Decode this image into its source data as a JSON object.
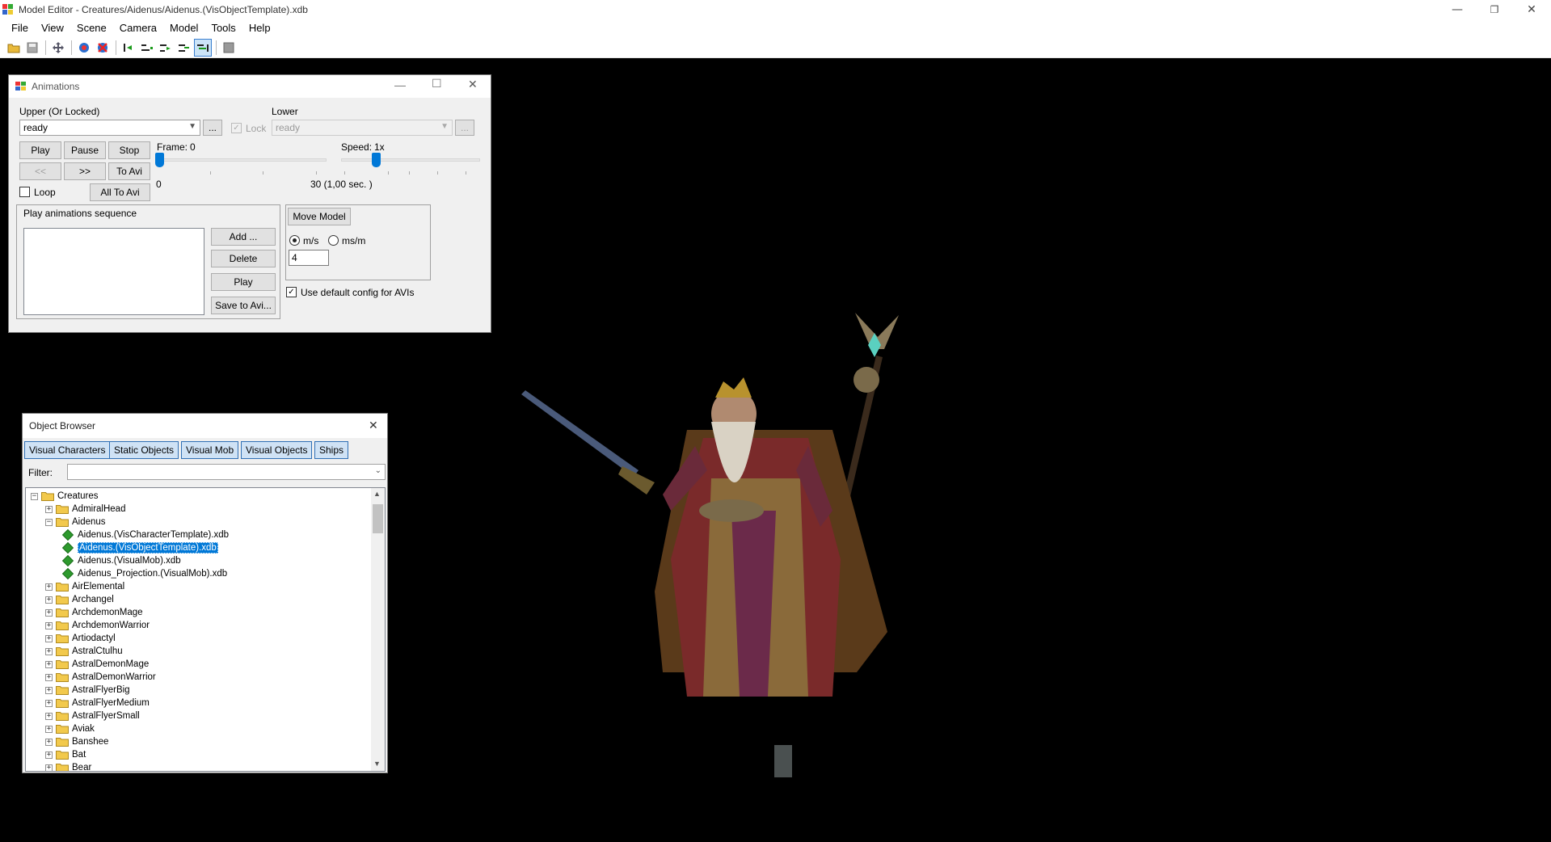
{
  "title": "Model Editor - Creatures/Aidenus/Aidenus.(VisObjectTemplate).xdb",
  "window_controls": {
    "minimize": "—",
    "restore": "❐",
    "close": "✕"
  },
  "menu": [
    "File",
    "View",
    "Scene",
    "Camera",
    "Model",
    "Tools",
    "Help"
  ],
  "toolbar_icons": [
    "open-icon",
    "save-icon",
    "move-icon",
    "reload-icon",
    "remove-icon",
    "anim-start-icon",
    "anim-prev-icon",
    "anim-next-icon",
    "anim-step-icon",
    "anim-end-icon",
    "grid-icon"
  ],
  "animations": {
    "title": "Animations",
    "upper_label": "Upper (Or Locked)",
    "upper_value": "ready",
    "upper_more": "...",
    "lock_label": "Lock",
    "lower_label": "Lower",
    "lower_value": "ready",
    "lower_more": "...",
    "play": "Play",
    "pause": "Pause",
    "stop": "Stop",
    "prev": "<<",
    "next": ">>",
    "to_avi": "To Avi",
    "loop": "Loop",
    "all_to_avi": "All To Avi",
    "frame_label": "Frame:",
    "frame_value": "0",
    "frame_min": "0",
    "frame_max": "30 (1,00 sec. )",
    "frame_position": 0,
    "speed_label": "Speed:",
    "speed_value": "1x",
    "speed_position": 0.25,
    "sequence_label": "Play animations sequence",
    "add": "Add ...",
    "delete": "Delete",
    "seq_play": "Play",
    "save_to_avi": "Save to Avi...",
    "move_model": "Move Model",
    "unit_ms": "m/s",
    "unit_msm": "ms/m",
    "move_value": "4",
    "use_default": "Use default config for AVIs"
  },
  "object_browser": {
    "title": "Object Browser",
    "tabs": [
      "Visual Characters",
      "Static Objects",
      "Visual Mob",
      "Visual Objects",
      "Ships"
    ],
    "filter_label": "Filter:",
    "filter_value": "",
    "tree": [
      {
        "label": "Creatures",
        "level": 0,
        "type": "folder",
        "expander": "−"
      },
      {
        "label": "AdmiralHead",
        "level": 1,
        "type": "folder",
        "expander": "+"
      },
      {
        "label": "Aidenus",
        "level": 1,
        "type": "folder",
        "expander": "−"
      },
      {
        "label": "Aidenus.(VisCharacterTemplate).xdb",
        "level": 2,
        "type": "file"
      },
      {
        "label": "Aidenus.(VisObjectTemplate).xdb",
        "level": 2,
        "type": "file",
        "selected": true
      },
      {
        "label": "Aidenus.(VisualMob).xdb",
        "level": 2,
        "type": "file"
      },
      {
        "label": "Aidenus_Projection.(VisualMob).xdb",
        "level": 2,
        "type": "file"
      },
      {
        "label": "AirElemental",
        "level": 1,
        "type": "folder",
        "expander": "+"
      },
      {
        "label": "Archangel",
        "level": 1,
        "type": "folder",
        "expander": "+"
      },
      {
        "label": "ArchdemonMage",
        "level": 1,
        "type": "folder",
        "expander": "+"
      },
      {
        "label": "ArchdemonWarrior",
        "level": 1,
        "type": "folder",
        "expander": "+"
      },
      {
        "label": "Artiodactyl",
        "level": 1,
        "type": "folder",
        "expander": "+"
      },
      {
        "label": "AstralCtulhu",
        "level": 1,
        "type": "folder",
        "expander": "+"
      },
      {
        "label": "AstralDemonMage",
        "level": 1,
        "type": "folder",
        "expander": "+"
      },
      {
        "label": "AstralDemonWarrior",
        "level": 1,
        "type": "folder",
        "expander": "+"
      },
      {
        "label": "AstralFlyerBig",
        "level": 1,
        "type": "folder",
        "expander": "+"
      },
      {
        "label": "AstralFlyerMedium",
        "level": 1,
        "type": "folder",
        "expander": "+"
      },
      {
        "label": "AstralFlyerSmall",
        "level": 1,
        "type": "folder",
        "expander": "+"
      },
      {
        "label": "Aviak",
        "level": 1,
        "type": "folder",
        "expander": "+"
      },
      {
        "label": "Banshee",
        "level": 1,
        "type": "folder",
        "expander": "+"
      },
      {
        "label": "Bat",
        "level": 1,
        "type": "folder",
        "expander": "+"
      },
      {
        "label": "Bear",
        "level": 1,
        "type": "folder",
        "expander": "+"
      }
    ]
  },
  "colors": {
    "viewport": "#000000",
    "accent": "#0078d7",
    "tab_bg": "#cfe2f5",
    "tab_border": "#2f6fb5",
    "file_icon": "#2d9a2d",
    "folder": "#f2c94c"
  }
}
